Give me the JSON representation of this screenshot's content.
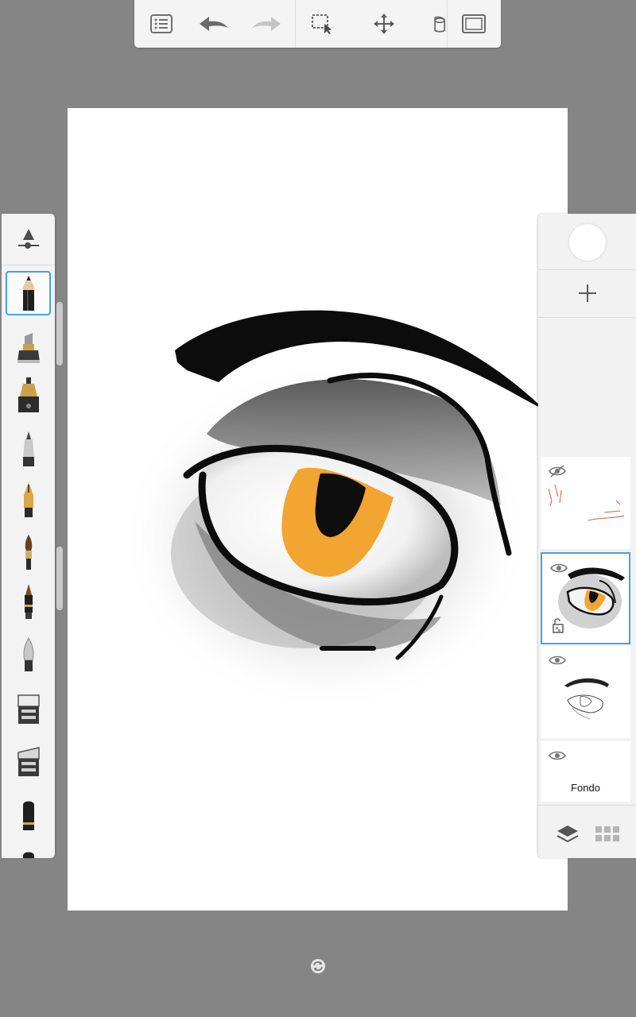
{
  "app": {
    "toolbar": {
      "items": [
        {
          "name": "menu",
          "icon": "list-menu-icon"
        },
        {
          "name": "undo",
          "icon": "undo-icon"
        },
        {
          "name": "redo",
          "icon": "redo-icon",
          "disabled": true
        },
        {
          "name": "selection",
          "icon": "selection-icon"
        },
        {
          "name": "transform",
          "icon": "move-icon"
        },
        {
          "name": "fill",
          "icon": "paint-bucket-icon"
        },
        {
          "name": "fullscreen",
          "icon": "fullscreen-icon"
        }
      ]
    },
    "brushes": {
      "properties_icon": "brush-properties-icon",
      "items": [
        {
          "name": "pencil",
          "icon": "pencil-icon",
          "selected": true
        },
        {
          "name": "marker",
          "icon": "marker-icon"
        },
        {
          "name": "ink-pen",
          "icon": "ink-pen-icon"
        },
        {
          "name": "ballpoint",
          "icon": "ballpoint-icon"
        },
        {
          "name": "fountain-pen",
          "icon": "fountain-pen-icon"
        },
        {
          "name": "paintbrush",
          "icon": "paintbrush-icon"
        },
        {
          "name": "airbrush",
          "icon": "airbrush-icon"
        },
        {
          "name": "smudge",
          "icon": "smudge-icon"
        },
        {
          "name": "soft-eraser",
          "icon": "eraser-icon"
        },
        {
          "name": "hard-eraser",
          "icon": "eraser-icon"
        },
        {
          "name": "blender",
          "icon": "blender-icon"
        }
      ]
    },
    "layers": {
      "current_color": "#ffffff",
      "add_icon": "plus-icon",
      "items": [
        {
          "name": "sketch-layer",
          "visible": false
        },
        {
          "name": "eye-layer",
          "visible": true,
          "active": true,
          "locked": false
        },
        {
          "name": "lineart-layer",
          "visible": true
        },
        {
          "name": "background-layer",
          "visible": true,
          "label": "Fondo"
        }
      ],
      "bottom": [
        "layers-icon",
        "grid-icon"
      ]
    },
    "colors": {
      "accent": "#4a9fe6",
      "iris": "#f2a530",
      "background": "#858585"
    }
  }
}
